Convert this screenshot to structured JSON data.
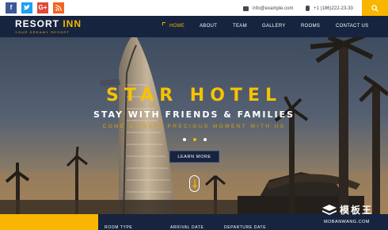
{
  "topbar": {
    "social": [
      {
        "name": "facebook-icon",
        "glyph": "f"
      },
      {
        "name": "twitter-icon",
        "glyph": "t"
      },
      {
        "name": "google-plus-icon",
        "glyph": "G+"
      },
      {
        "name": "rss-icon",
        "glyph": ")"
      }
    ],
    "email": "info@example.com",
    "phone": "+1 (186)222-23-33"
  },
  "nav": {
    "logo_main": "RESORT ",
    "logo_accent": "INN",
    "tagline": "YOUR DREAMY RESORT",
    "items": [
      {
        "label": "HOME",
        "active": true
      },
      {
        "label": "ABOUT"
      },
      {
        "label": "TEAM"
      },
      {
        "label": "GALLERY"
      },
      {
        "label": "ROOMS"
      },
      {
        "label": "CONTACT US"
      }
    ]
  },
  "hero": {
    "title": "STAR HOTEL",
    "subtitle": "STAY WITH FRIENDS & FAMILIES",
    "subtitle2": "COME & ENJOY PRECIOUS MOMENT WITH US",
    "button": "LEARN MORE",
    "slides": 3,
    "active_slide": 2
  },
  "booking": {
    "room_type": "ROOM TYPE",
    "arrival": "ARRIVAL DATE",
    "departure": "DEPARTURE DATE"
  },
  "watermark": {
    "cn": "模板王",
    "en": "MOBANWANG.COM"
  },
  "colors": {
    "navy": "#16243f",
    "accent": "#f8b600"
  }
}
